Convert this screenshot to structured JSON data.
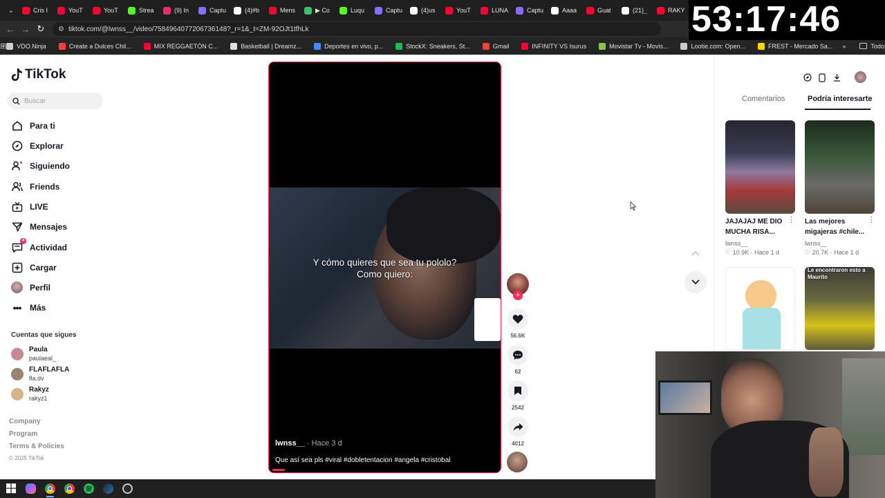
{
  "browser": {
    "tabs": [
      {
        "title": "Cris I",
        "color": "#ff0033"
      },
      {
        "title": "YouT",
        "color": "#ff0033"
      },
      {
        "title": "YouT",
        "color": "#ff0033"
      },
      {
        "title": "Strea",
        "color": "#53fc18"
      },
      {
        "title": "(9) In",
        "color": "#e1306c"
      },
      {
        "title": "Captu",
        "color": "#8a6cff"
      },
      {
        "title": "(4)#b",
        "color": "#ffffff"
      },
      {
        "title": "Mens",
        "color": "#ff0033"
      },
      {
        "title": "▶ Co",
        "color": "#3fbf6a"
      },
      {
        "title": "Luqu",
        "color": "#53fc18"
      },
      {
        "title": "Captu",
        "color": "#8a6cff"
      },
      {
        "title": "(4)us",
        "color": "#ffffff"
      },
      {
        "title": "YouT",
        "color": "#ff0033"
      },
      {
        "title": "LUNA",
        "color": "#ff0033"
      },
      {
        "title": "Captu",
        "color": "#8a6cff"
      },
      {
        "title": "Aaaa",
        "color": "#ffffff"
      },
      {
        "title": "Guat",
        "color": "#ff0033"
      },
      {
        "title": "(21)_",
        "color": "#ffffff"
      },
      {
        "title": "RAKY",
        "color": "#ff0033"
      }
    ],
    "url": "tiktok.com/@lwnss__/video/7584964077206736148?_r=1&_t=ZM-92OJt1tfhLk",
    "bookmarks": [
      {
        "label": "VDO.Ninja",
        "color": "#cfcfcf"
      },
      {
        "label": "Create a Dulces Chil...",
        "color": "#ff3b3b"
      },
      {
        "label": "MIX REGGAETÓN C...",
        "color": "#ff0033"
      },
      {
        "label": "Basketball | Dreamz...",
        "color": "#dddddd"
      },
      {
        "label": "Deportes en vivo, p...",
        "color": "#3b8cff"
      },
      {
        "label": "StockX: Sneakers, St...",
        "color": "#1db954"
      },
      {
        "label": "Gmail",
        "color": "#ea4335"
      },
      {
        "label": "INFINITY VS Isurus",
        "color": "#ff0033"
      },
      {
        "label": "Movistar Tv - Movis...",
        "color": "#8bc34a"
      },
      {
        "label": "Lootie.com: Open...",
        "color": "#cccccc"
      },
      {
        "label": "FREST - Mercado Sa...",
        "color": "#ffd600"
      }
    ],
    "all_bookmarks": "Todos los marcadores"
  },
  "timer": "53:17:46",
  "tiktok": {
    "logo": "TikTok",
    "search_placeholder": "Buscar",
    "nav": [
      {
        "label": "Para ti",
        "icon": "home-icon"
      },
      {
        "label": "Explorar",
        "icon": "compass-icon"
      },
      {
        "label": "Siguiendo",
        "icon": "following-icon"
      },
      {
        "label": "Friends",
        "icon": "friends-icon"
      },
      {
        "label": "LIVE",
        "icon": "live-icon"
      },
      {
        "label": "Mensajes",
        "icon": "messages-icon"
      },
      {
        "label": "Actividad",
        "icon": "activity-icon",
        "badge": "4"
      },
      {
        "label": "Cargar",
        "icon": "upload-icon"
      },
      {
        "label": "Perfil",
        "icon": "profile-icon"
      },
      {
        "label": "Más",
        "icon": "more-icon"
      }
    ],
    "following_title": "Cuentas que sigues",
    "following": [
      {
        "name": "Paula",
        "handle": "paulaeal_",
        "color": "#c98a8f"
      },
      {
        "name": "FLAFLAFLA",
        "handle": "fla.dv",
        "color": "#9a8572"
      },
      {
        "name": "Rakyz",
        "handle": "rakyz1",
        "color": "#d6b48a"
      }
    ],
    "footer": {
      "links": [
        "Company",
        "Program",
        "Terms & Policies"
      ],
      "copyright": "© 2025 TikTok"
    },
    "video": {
      "subtitle_line1": "Y cómo quieres que sea tu pololo?",
      "subtitle_line2": "Como quiero:",
      "author": "lwnss__",
      "time": "· Hace 3 d",
      "description": "Que así sea pls #viral #dobletentacion #angela #cristobal",
      "likes": "56.6K",
      "comments": "62",
      "saves": "2542",
      "shares": "4012"
    },
    "panel": {
      "tabs": [
        "Comentarios",
        "Podría interesarte"
      ],
      "cards": [
        {
          "title_l1": "JAJAJAJ ME DIO",
          "title_l2": "MUCHA RISA...",
          "author": "lwnss__",
          "likes": "10.9K",
          "time": "Hace 1 d"
        },
        {
          "title_l1": "Las mejores",
          "title_l2": "migajeras #chile...",
          "author": "lwnss__",
          "likes": "20.7K",
          "time": "Hace 1 d"
        }
      ],
      "card4_banner": "Le encontraron esto a Maurito"
    }
  }
}
